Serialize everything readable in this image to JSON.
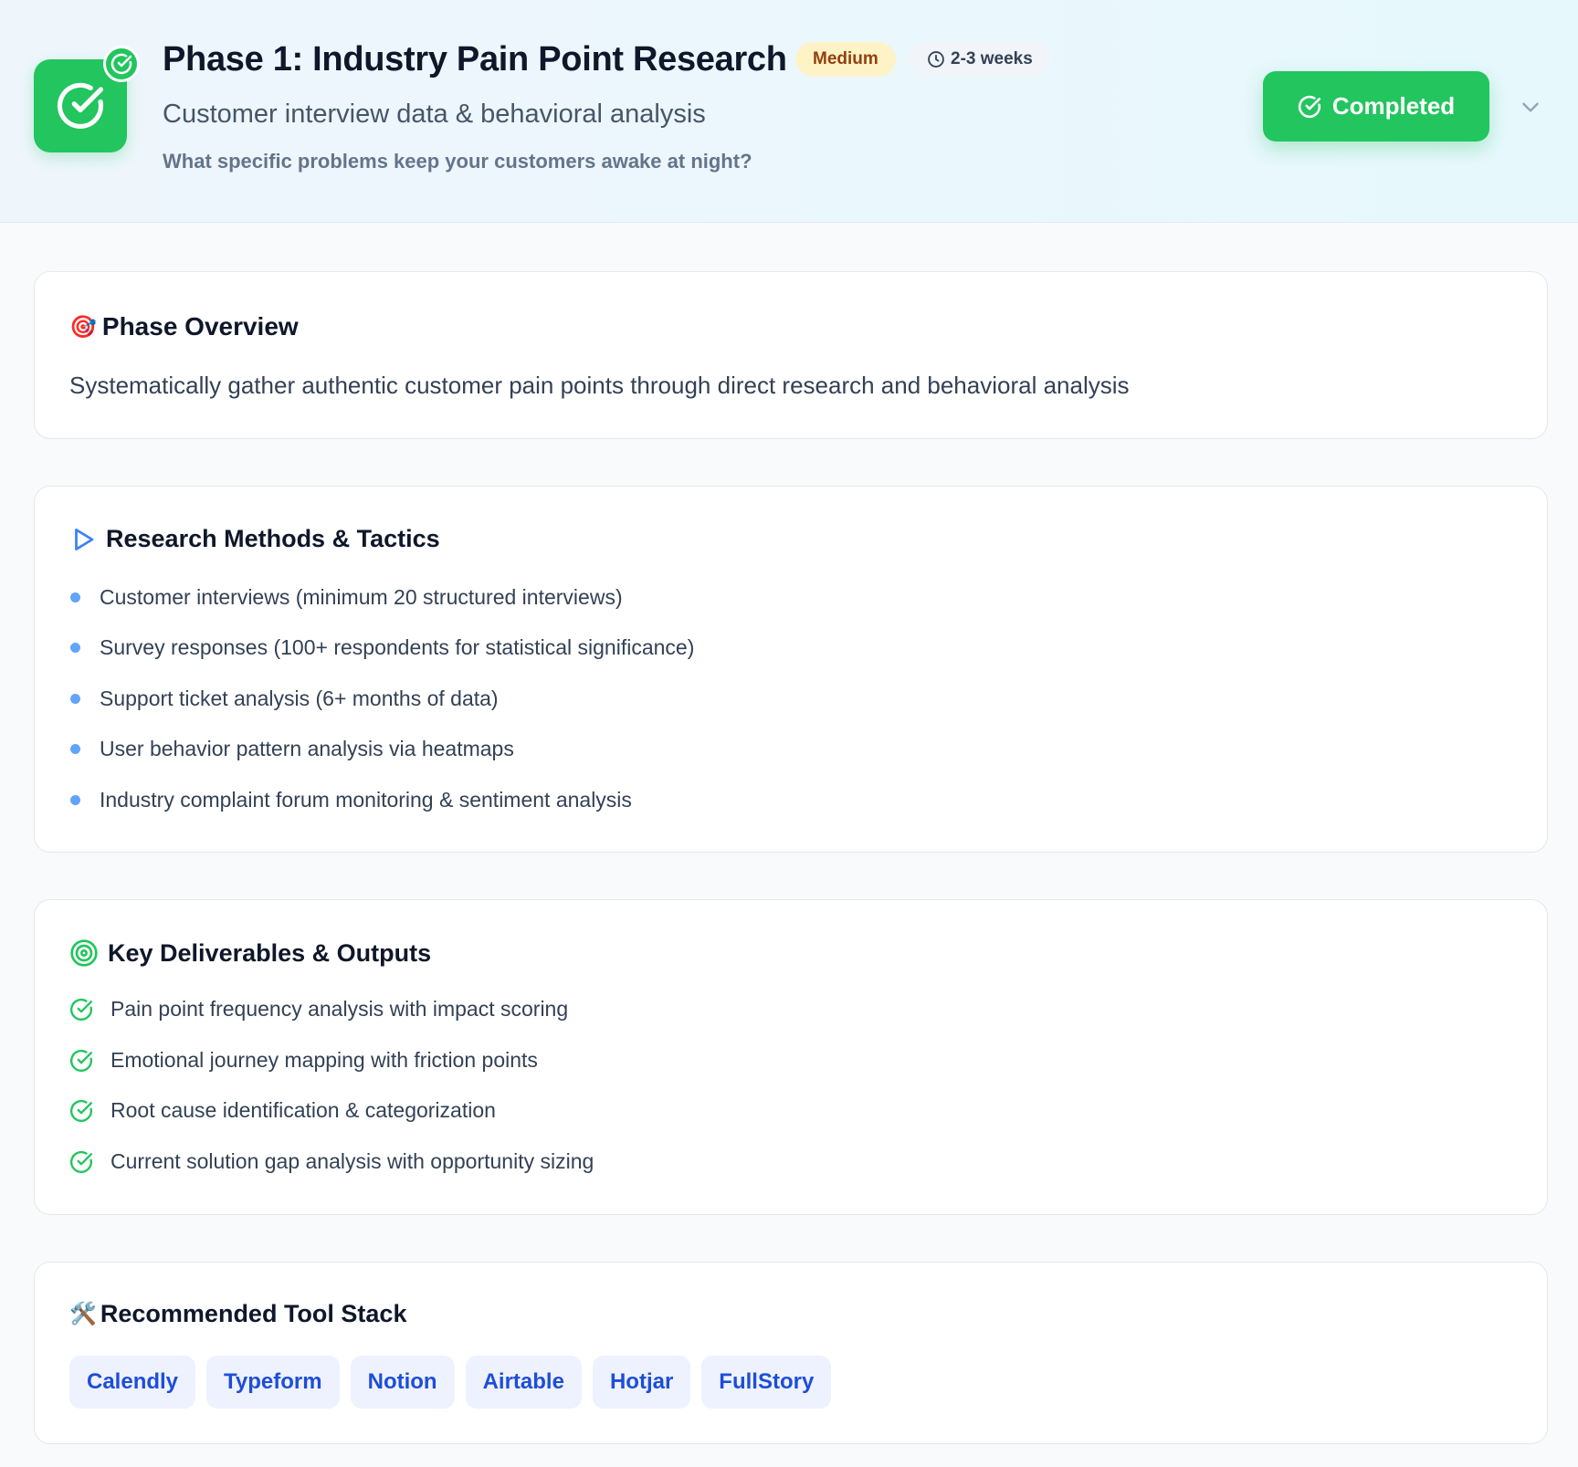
{
  "header": {
    "title": "Phase 1: Industry Pain Point Research",
    "difficulty": "Medium",
    "duration": "2-3 weeks",
    "subtitle": "Customer interview data & behavioral analysis",
    "question": "What specific problems keep your customers awake at night?",
    "status_button": "Completed"
  },
  "overview": {
    "emoji": "🎯",
    "title": "Phase Overview",
    "text": "Systematically gather authentic customer pain points through direct research and behavioral analysis"
  },
  "methods": {
    "title": "Research Methods & Tactics",
    "items": [
      "Customer interviews (minimum 20 structured interviews)",
      "Survey responses (100+ respondents for statistical significance)",
      "Support ticket analysis (6+ months of data)",
      "User behavior pattern analysis via heatmaps",
      "Industry complaint forum monitoring & sentiment analysis"
    ]
  },
  "deliverables": {
    "title": "Key Deliverables & Outputs",
    "items": [
      "Pain point frequency analysis with impact scoring",
      "Emotional journey mapping with friction points",
      "Root cause identification & categorization",
      "Current solution gap analysis with opportunity sizing"
    ]
  },
  "tools": {
    "emoji": "🛠️",
    "title": "Recommended Tool Stack",
    "items": [
      "Calendly",
      "Typeform",
      "Notion",
      "Airtable",
      "Hotjar",
      "FullStory"
    ]
  },
  "colors": {
    "success": "#22c55e",
    "accent_blue": "#3b82f6",
    "badge_yellow": "#fef3c7",
    "chip_bg": "#eef2ff",
    "chip_text": "#1d4ed8"
  },
  "icons": {
    "phase": "check-circle-icon",
    "duration": "clock-icon",
    "methods": "play-triangle-icon",
    "deliverables": "target-icon",
    "deliverable_item": "check-circle-icon",
    "expand": "chevron-down-icon"
  }
}
